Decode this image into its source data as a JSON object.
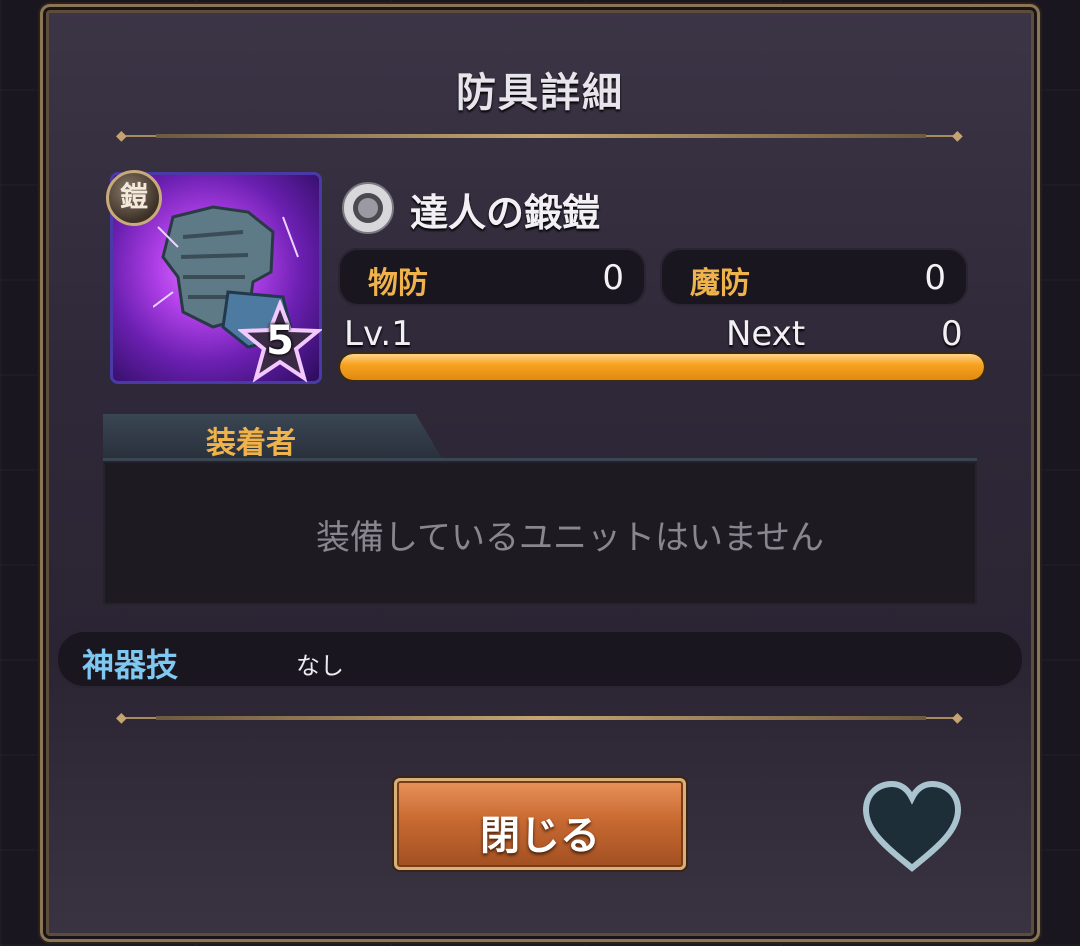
{
  "dialog": {
    "title": "防具詳細"
  },
  "item": {
    "type_badge": "鎧",
    "rarity": "5",
    "element_icon": "neutral-circle-icon",
    "name": "達人の鍛鎧"
  },
  "stats": {
    "physical_defense_label": "物防",
    "physical_defense_value": "0",
    "magic_defense_label": "魔防",
    "magic_defense_value": "0"
  },
  "level": {
    "level_text": "Lv.1",
    "next_label": "Next",
    "next_value": "0",
    "exp_progress": 1.0
  },
  "equipped_by": {
    "tab_label": "装着者",
    "empty_message": "装備しているユニットはいません"
  },
  "skill": {
    "label": "神器技",
    "value": "なし"
  },
  "buttons": {
    "close_label": "閉じる",
    "favorite_icon": "heart-icon"
  },
  "colors": {
    "accent_orange": "#f0b24a",
    "skill_blue": "#7fc8f2",
    "exp_bar": "#f7a320",
    "close_button": "#c86a32"
  }
}
